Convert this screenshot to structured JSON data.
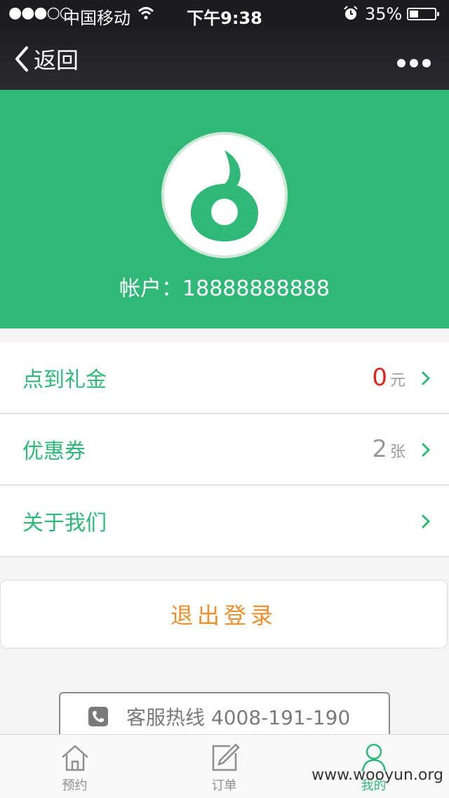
{
  "status_bar": {
    "signal": "●●●○○",
    "carrier": "中国移动",
    "time": "下午9:38",
    "battery_percent": "35%",
    "battery_level": 0.35
  },
  "nav": {
    "back_label": "返回"
  },
  "profile": {
    "account": "帐户：18888888888"
  },
  "menu": [
    {
      "label": "点到礼金",
      "value": "0",
      "unit": "元"
    },
    {
      "label": "优惠券",
      "value": "2",
      "unit": "张"
    },
    {
      "label": "关于我们",
      "value": "",
      "unit": ""
    }
  ],
  "logout_label": "退出登录",
  "hotline_label": "客服热线 4008-191-190",
  "tabs": [
    {
      "label": "预约",
      "icon": "home-icon"
    },
    {
      "label": "订单",
      "icon": "edit-icon"
    },
    {
      "label": "我的",
      "icon": "user-icon",
      "active": true
    }
  ],
  "watermark": "www.wooyun.org",
  "colors": {
    "brand_green": "#2fb877",
    "accent_orange": "#f0902c",
    "value_red": "#e2231a"
  }
}
